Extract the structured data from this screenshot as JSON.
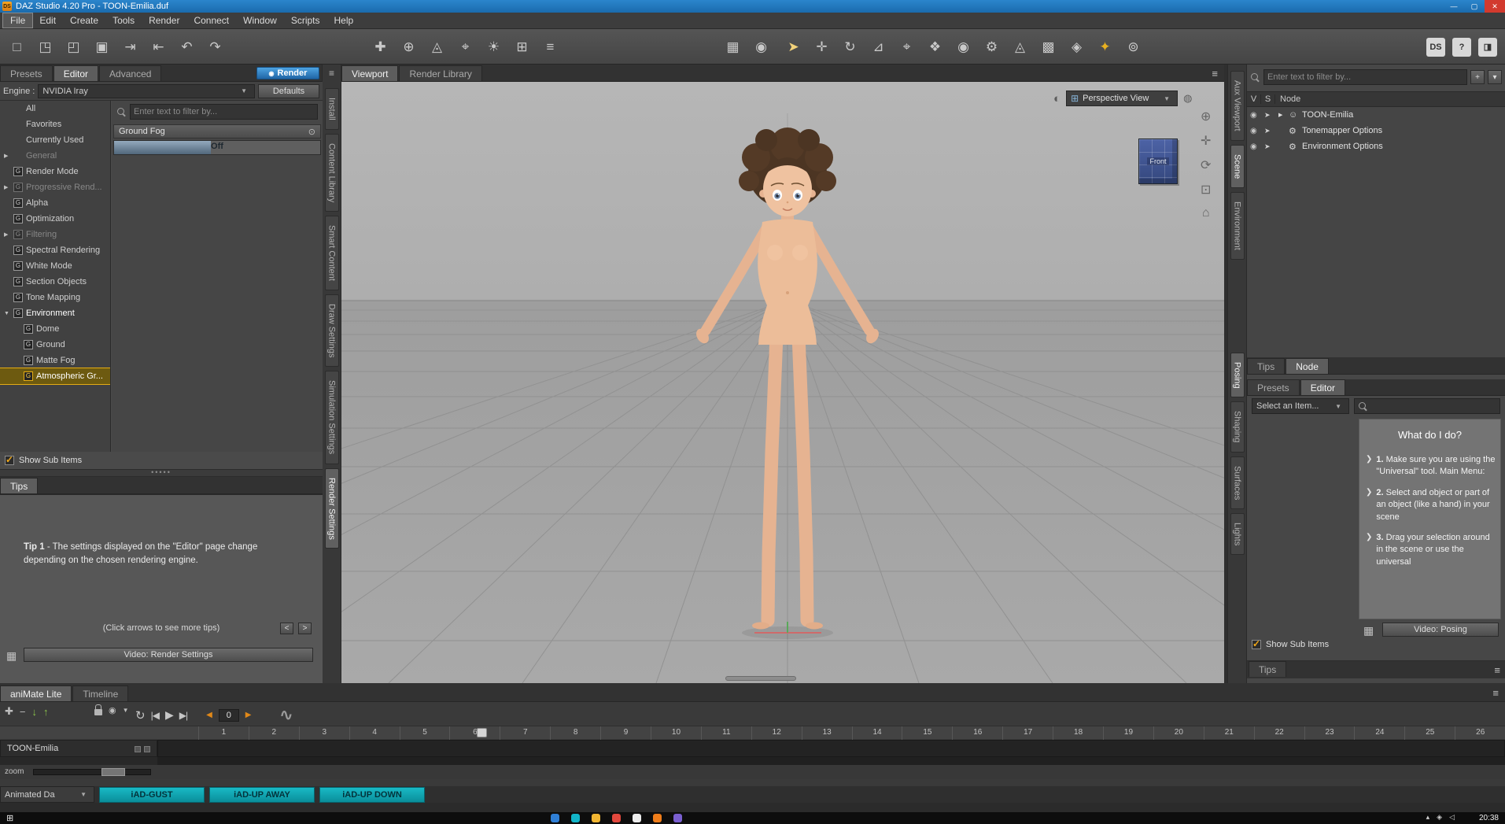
{
  "titlebar": {
    "app_badge": "DS",
    "title": "DAZ Studio 4.20 Pro - TOON-Emilia.duf",
    "minimize": "—",
    "maximize": "▢",
    "close": "✕"
  },
  "menu": {
    "items": [
      {
        "label": "File",
        "state": "active",
        "name": "menu-file"
      },
      {
        "label": "Edit",
        "name": "menu-edit"
      },
      {
        "label": "Create",
        "name": "menu-create"
      },
      {
        "label": "Tools",
        "name": "menu-tools"
      },
      {
        "label": "Render",
        "name": "menu-render"
      },
      {
        "label": "Connect",
        "name": "menu-connect"
      },
      {
        "label": "Window",
        "name": "menu-window"
      },
      {
        "label": "Scripts",
        "name": "menu-scripts"
      },
      {
        "label": "Help",
        "name": "menu-help"
      }
    ]
  },
  "toolbar": {
    "file_group": [
      {
        "name": "new-file-icon",
        "glyph": "□"
      },
      {
        "name": "open-file-icon",
        "glyph": "◳"
      },
      {
        "name": "merge-file-icon",
        "glyph": "◰"
      },
      {
        "name": "save-icon",
        "glyph": "▣"
      },
      {
        "name": "import-icon",
        "glyph": "⇥"
      },
      {
        "name": "export-icon",
        "glyph": "⇤"
      },
      {
        "name": "undo-icon",
        "glyph": "↶"
      },
      {
        "name": "redo-icon",
        "glyph": "↷"
      }
    ],
    "create_group": [
      {
        "name": "create-figure-icon",
        "glyph": "✚"
      },
      {
        "name": "create-node-icon",
        "glyph": "⊕"
      },
      {
        "name": "create-null-icon",
        "glyph": "◬"
      },
      {
        "name": "create-camera-icon",
        "glyph": "⌖"
      },
      {
        "name": "create-light-icon",
        "glyph": "☀"
      },
      {
        "name": "create-group-icon",
        "glyph": "⊞"
      },
      {
        "name": "scripts-menu-icon",
        "glyph": "≡"
      }
    ],
    "view_group": [
      {
        "name": "grid-snap-icon",
        "glyph": "▦"
      },
      {
        "name": "sphere-view-icon",
        "glyph": "◉"
      }
    ],
    "tool_group": [
      {
        "name": "universal-tool-icon",
        "glyph": "➤",
        "color": "#f2d27a"
      },
      {
        "name": "translate-tool-icon",
        "glyph": "✛"
      },
      {
        "name": "rotate-tool-icon",
        "glyph": "↻"
      },
      {
        "name": "scale-tool-icon",
        "glyph": "⊿"
      },
      {
        "name": "node-selection-tool-icon",
        "glyph": "⌖"
      },
      {
        "name": "active-pose-tool-icon",
        "glyph": "❖"
      },
      {
        "name": "dform-tool-icon",
        "glyph": "◉"
      },
      {
        "name": "joint-editor-icon",
        "glyph": "⚙"
      },
      {
        "name": "geometry-editor-icon",
        "glyph": "◬"
      },
      {
        "name": "polygon-group-editor-icon",
        "glyph": "▩"
      },
      {
        "name": "surface-selection-icon",
        "glyph": "◈"
      },
      {
        "name": "spot-render-tool-icon",
        "glyph": "✦",
        "color": "#e8b020"
      },
      {
        "name": "aim-tool-icon",
        "glyph": "⊚"
      }
    ],
    "right_group": [
      {
        "name": "daz-central-badge",
        "glyph": "DS"
      },
      {
        "name": "help-icon",
        "glyph": "?"
      },
      {
        "name": "interactive-lessons-icon",
        "glyph": "◨"
      }
    ]
  },
  "dock_left": {
    "tabs": [
      {
        "label": "Install",
        "name": "tab-install"
      },
      {
        "label": "Content Library",
        "name": "tab-content-library"
      },
      {
        "label": "Smart Content",
        "name": "tab-smart-content"
      },
      {
        "label": "Draw Settings",
        "name": "tab-draw-settings"
      },
      {
        "label": "Simulation Settings",
        "name": "tab-simulation-settings"
      },
      {
        "label": "Render Settings",
        "state": "active",
        "name": "tab-render-settings"
      }
    ]
  },
  "render_settings": {
    "tabs": [
      "Presets",
      "Editor",
      "Advanced"
    ],
    "render_button": "Render",
    "engine_label": "Engine :",
    "engine_value": "NVIDIA Iray",
    "defaults_button": "Defaults",
    "filter_placeholder": "Enter text to filter by...",
    "categories": [
      {
        "label": "All",
        "icon": "",
        "arrow": "",
        "indent": 0
      },
      {
        "label": "Favorites",
        "icon": "",
        "arrow": "",
        "indent": 0
      },
      {
        "label": "Currently Used",
        "icon": "",
        "arrow": "",
        "indent": 0
      },
      {
        "label": "General",
        "icon": "",
        "arrow": "▶",
        "indent": 0,
        "state": "dim"
      },
      {
        "label": "Render Mode",
        "icon": "G",
        "arrow": "",
        "indent": 0
      },
      {
        "label": "Progressive Rend...",
        "icon": "G",
        "arrow": "▶",
        "indent": 0,
        "state": "dim"
      },
      {
        "label": "Alpha",
        "icon": "G",
        "arrow": "",
        "indent": 0
      },
      {
        "label": "Optimization",
        "icon": "G",
        "arrow": "",
        "indent": 0
      },
      {
        "label": "Filtering",
        "icon": "G",
        "arrow": "▶",
        "indent": 0,
        "state": "dim"
      },
      {
        "label": "Spectral Rendering",
        "icon": "G",
        "arrow": "",
        "indent": 0
      },
      {
        "label": "White Mode",
        "icon": "G",
        "arrow": "",
        "indent": 0
      },
      {
        "label": "Section Objects",
        "icon": "G",
        "arrow": "",
        "indent": 0
      },
      {
        "label": "Tone Mapping",
        "icon": "G",
        "arrow": "",
        "indent": 0
      },
      {
        "label": "Environment",
        "icon": "G",
        "arrow": "▼",
        "indent": 0,
        "state": "expanded"
      },
      {
        "label": "Dome",
        "icon": "G",
        "arrow": "",
        "indent": 1
      },
      {
        "label": "Ground",
        "icon": "G",
        "arrow": "",
        "indent": 1
      },
      {
        "label": "Matte Fog",
        "icon": "G",
        "arrow": "",
        "indent": 1
      },
      {
        "label": "Atmospheric Gr...",
        "icon": "G",
        "arrow": "",
        "indent": 1,
        "state": "selected",
        "name": "category-atmospheric-ground"
      }
    ],
    "show_sub_items": "Show Sub Items",
    "group_header": "Ground Fog",
    "fog_value": "Off",
    "tips": {
      "tab": "Tips",
      "tip_label": "Tip 1",
      "tip_text": " - The settings displayed on the \"Editor\" page change depending on the chosen rendering engine.",
      "nav_hint": "(Click arrows to see more tips)",
      "prev": "<",
      "next": ">",
      "video_button": "Video: Render Settings"
    }
  },
  "viewport": {
    "tabs": [
      "Viewport",
      "Render Library"
    ],
    "view_selector": "Perspective View",
    "cube_label": "Front"
  },
  "dock_right": {
    "top_tabs": [
      {
        "label": "Aux Viewport",
        "name": "tab-aux-viewport"
      },
      {
        "label": "Scene",
        "state": "active",
        "name": "tab-scene"
      },
      {
        "label": "Environment",
        "name": "tab-environment"
      }
    ],
    "bottom_tabs": [
      {
        "label": "Posing",
        "state": "active",
        "name": "tab-posing"
      },
      {
        "label": "Shaping",
        "name": "tab-shaping"
      },
      {
        "label": "Surfaces",
        "name": "tab-surfaces"
      },
      {
        "label": "Lights",
        "name": "tab-lights"
      }
    ]
  },
  "scene_panel": {
    "filter_placeholder": "Enter text to filter by...",
    "columns": [
      "V",
      "S",
      "Node"
    ],
    "nodes": [
      {
        "label": "TOON-Emilia",
        "icon": "☺",
        "arrow": "▶",
        "name": "scene-node-toon-emilia"
      },
      {
        "label": "Tonemapper Options",
        "icon": "⚙",
        "arrow": "",
        "name": "scene-node-tonemapper-options"
      },
      {
        "label": "Environment Options",
        "icon": "⚙",
        "arrow": "",
        "name": "scene-node-environment-options"
      }
    ],
    "bottom_tabs": [
      "Tips",
      "Node"
    ]
  },
  "posing_panel": {
    "tabs": [
      "Presets",
      "Editor"
    ],
    "select_value": "Select an Item...",
    "help_title": "What do I do?",
    "steps": [
      {
        "num": "1.",
        "text": "Make sure you are using the \"Universal\" tool. Main Menu:"
      },
      {
        "num": "2.",
        "text": "Select and object or part of an object (like a hand) in your scene"
      },
      {
        "num": "3.",
        "text": "Drag your selection around in the scene or use the universal"
      }
    ],
    "video_button": "Video: Posing",
    "show_sub_items": "Show Sub Items",
    "tips_tab": "Tips"
  },
  "timeline": {
    "tabs": [
      "aniMate Lite",
      "Timeline"
    ],
    "frame_value": "0",
    "ruler": [
      "1",
      "2",
      "3",
      "4",
      "5",
      "6",
      "7",
      "8",
      "9",
      "10",
      "11",
      "12",
      "13",
      "14",
      "15",
      "16",
      "17",
      "18",
      "19",
      "20",
      "21",
      "22",
      "23",
      "24",
      "25",
      "26"
    ],
    "track_label": "TOON-Emilia",
    "zoom_label": "zoom",
    "clip_source": "Animated Da",
    "clips": [
      {
        "label": "iAD-GUST",
        "name": "aniblock-iad-gust"
      },
      {
        "label": "iAD-UP AWAY",
        "name": "aniblock-iad-up-away"
      },
      {
        "label": "iAD-UP DOWN",
        "name": "aniblock-iad-up-down"
      }
    ]
  },
  "taskbar": {
    "start_glyph": "⊞",
    "apps": [
      {
        "name": "taskbar-app-icon",
        "color": "#2f7fd6"
      },
      {
        "name": "taskbar-app-icon",
        "color": "#12b5c9"
      },
      {
        "name": "taskbar-app-icon",
        "color": "#f2b632"
      },
      {
        "name": "taskbar-app-icon",
        "color": "#e2483d"
      },
      {
        "name": "taskbar-app-icon",
        "color": "#ececec"
      },
      {
        "name": "taskbar-app-icon",
        "color": "#ef7d1a"
      },
      {
        "name": "taskbar-app-icon",
        "color": "#7a5fd0"
      }
    ],
    "clock": "20:38"
  }
}
